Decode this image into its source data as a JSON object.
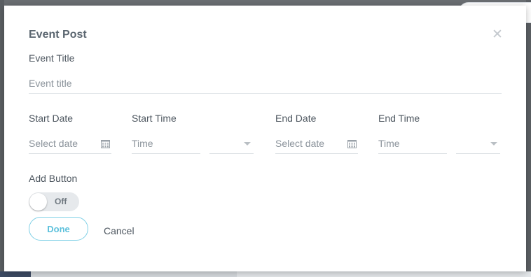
{
  "modal": {
    "title": "Event Post",
    "close_icon": "close-icon"
  },
  "event_title": {
    "label": "Event Title",
    "placeholder": "Event title"
  },
  "start_date": {
    "label": "Start Date",
    "placeholder": "Select date",
    "icon": "calendar-icon"
  },
  "start_time": {
    "label": "Start Time",
    "placeholder": "Time",
    "ampm_selected": ""
  },
  "end_date": {
    "label": "End Date",
    "placeholder": "Select date",
    "icon": "calendar-icon"
  },
  "end_time": {
    "label": "End Time",
    "placeholder": "Time",
    "ampm_selected": ""
  },
  "add_button": {
    "label": "Add Button",
    "toggle_state": "Off"
  },
  "actions": {
    "done_label": "Done",
    "cancel_label": "Cancel"
  },
  "colors": {
    "accent": "#5ec1dc",
    "accent_border": "#7fd0e6",
    "text": "#4e5760",
    "placeholder": "#8b939b"
  }
}
